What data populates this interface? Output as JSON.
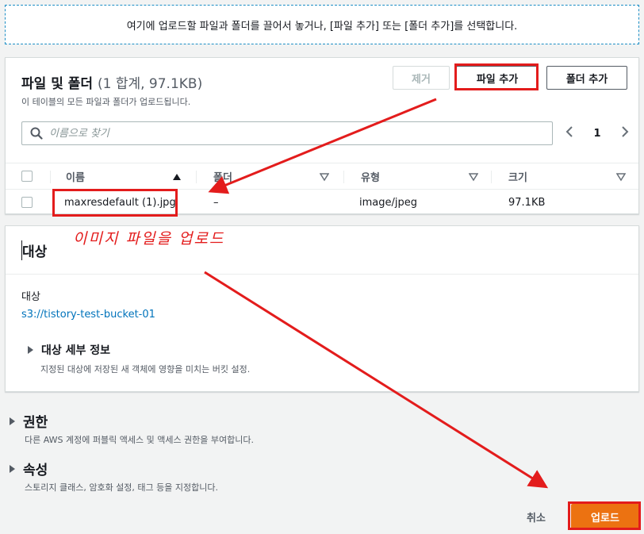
{
  "dropzone": {
    "text": "여기에 업로드할 파일과 폴더를 끌어서 놓거나, [파일 추가] 또는 [폴더 추가]를 선택합니다."
  },
  "files": {
    "title": "파일 및 폴더",
    "count": "(1 합계, 97.1KB)",
    "description": "이 테이블의 모든 파일과 폴더가 업로드됩니다.",
    "remove_label": "제거",
    "add_file_label": "파일 추가",
    "add_folder_label": "폴더 추가",
    "search_placeholder": "이름으로 찾기",
    "search_value": "",
    "page_number": "1",
    "columns": [
      "이름",
      "폴더",
      "유형",
      "크기"
    ],
    "rows": [
      {
        "name": "maxresdefault (1).jpg",
        "folder": "–",
        "type": "image/jpeg",
        "size": "97.1KB"
      }
    ]
  },
  "destination": {
    "title": "대상",
    "label": "대상",
    "bucket_link": "s3://tistory-test-bucket-01",
    "details_title": "대상 세부 정보",
    "details_desc": "지정된 대상에 저장된 새 객체에 영향을 미치는 버킷 설정."
  },
  "permissions": {
    "title": "권한",
    "desc": "다른 AWS 계정에 퍼블릭 액세스 및 액세스 권한을 부여합니다."
  },
  "properties": {
    "title": "속성",
    "desc": "스토리지 클래스, 암호화 설정, 태그 등을 지정합니다."
  },
  "footer": {
    "cancel_label": "취소",
    "upload_label": "업로드"
  },
  "annotation": {
    "text": "이미지 파일을 업로드",
    "color": "#e31c1c"
  },
  "colors": {
    "accent": "#ec7211",
    "link": "#0073bb",
    "annotation": "#e31c1c"
  }
}
